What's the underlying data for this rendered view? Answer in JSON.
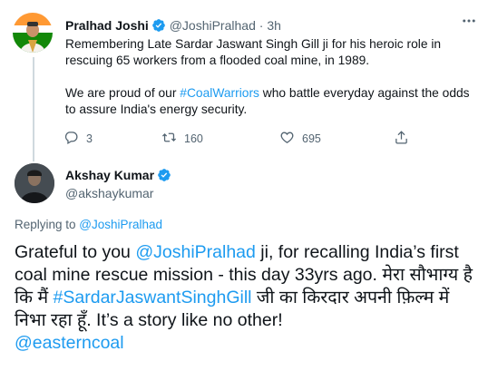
{
  "parent_tweet": {
    "name": "Pralhad Joshi",
    "handle": "@JoshiPralhad",
    "separator": "·",
    "time": "3h",
    "text_line1": "Remembering Late Sardar Jaswant Singh Gill ji for his heroic role in rescuing 65 workers from a flooded coal mine, in 1989.",
    "text2_prefix": "We are proud of our ",
    "text2_hashtag": "#CoalWarriors",
    "text2_suffix": " who battle everyday against the odds to assure India's energy security.",
    "replies": "3",
    "retweets": "160",
    "likes": "695"
  },
  "main_tweet": {
    "name": "Akshay Kumar",
    "handle": "@akshaykumar",
    "replying_prefix": "Replying to ",
    "replying_to": "@JoshiPralhad",
    "text_a": "Grateful to you ",
    "mention_1": "@JoshiPralhad",
    "text_b": " ji, for recalling India’s first coal mine rescue mission - this day 33yrs ago. मेरा सौभाग्य है कि मैं ",
    "hashtag": "#SardarJaswantSinghGill",
    "text_c": " जी का किरदार अपनी फ़िल्म में निभा रहा हूँ. It’s a story like no other!",
    "mention_2": "@easterncoal"
  },
  "colors": {
    "link": "#1d9bf0",
    "verified": "#1d9bf0",
    "secondary_text": "#536471",
    "thread_line": "#cfd9de"
  },
  "icons": [
    "verified-badge-icon",
    "more-icon",
    "reply-icon",
    "retweet-icon",
    "like-icon",
    "share-icon"
  ]
}
